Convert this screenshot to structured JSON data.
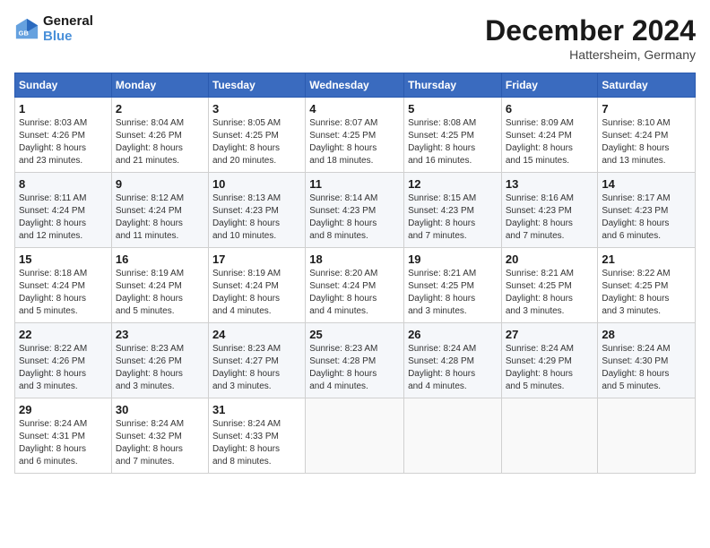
{
  "header": {
    "logo_line1": "General",
    "logo_line2": "Blue",
    "month_title": "December 2024",
    "location": "Hattersheim, Germany"
  },
  "days_of_week": [
    "Sunday",
    "Monday",
    "Tuesday",
    "Wednesday",
    "Thursday",
    "Friday",
    "Saturday"
  ],
  "weeks": [
    [
      {
        "day": "1",
        "info": "Sunrise: 8:03 AM\nSunset: 4:26 PM\nDaylight: 8 hours\nand 23 minutes."
      },
      {
        "day": "2",
        "info": "Sunrise: 8:04 AM\nSunset: 4:26 PM\nDaylight: 8 hours\nand 21 minutes."
      },
      {
        "day": "3",
        "info": "Sunrise: 8:05 AM\nSunset: 4:25 PM\nDaylight: 8 hours\nand 20 minutes."
      },
      {
        "day": "4",
        "info": "Sunrise: 8:07 AM\nSunset: 4:25 PM\nDaylight: 8 hours\nand 18 minutes."
      },
      {
        "day": "5",
        "info": "Sunrise: 8:08 AM\nSunset: 4:25 PM\nDaylight: 8 hours\nand 16 minutes."
      },
      {
        "day": "6",
        "info": "Sunrise: 8:09 AM\nSunset: 4:24 PM\nDaylight: 8 hours\nand 15 minutes."
      },
      {
        "day": "7",
        "info": "Sunrise: 8:10 AM\nSunset: 4:24 PM\nDaylight: 8 hours\nand 13 minutes."
      }
    ],
    [
      {
        "day": "8",
        "info": "Sunrise: 8:11 AM\nSunset: 4:24 PM\nDaylight: 8 hours\nand 12 minutes."
      },
      {
        "day": "9",
        "info": "Sunrise: 8:12 AM\nSunset: 4:24 PM\nDaylight: 8 hours\nand 11 minutes."
      },
      {
        "day": "10",
        "info": "Sunrise: 8:13 AM\nSunset: 4:23 PM\nDaylight: 8 hours\nand 10 minutes."
      },
      {
        "day": "11",
        "info": "Sunrise: 8:14 AM\nSunset: 4:23 PM\nDaylight: 8 hours\nand 8 minutes."
      },
      {
        "day": "12",
        "info": "Sunrise: 8:15 AM\nSunset: 4:23 PM\nDaylight: 8 hours\nand 7 minutes."
      },
      {
        "day": "13",
        "info": "Sunrise: 8:16 AM\nSunset: 4:23 PM\nDaylight: 8 hours\nand 7 minutes."
      },
      {
        "day": "14",
        "info": "Sunrise: 8:17 AM\nSunset: 4:23 PM\nDaylight: 8 hours\nand 6 minutes."
      }
    ],
    [
      {
        "day": "15",
        "info": "Sunrise: 8:18 AM\nSunset: 4:24 PM\nDaylight: 8 hours\nand 5 minutes."
      },
      {
        "day": "16",
        "info": "Sunrise: 8:19 AM\nSunset: 4:24 PM\nDaylight: 8 hours\nand 5 minutes."
      },
      {
        "day": "17",
        "info": "Sunrise: 8:19 AM\nSunset: 4:24 PM\nDaylight: 8 hours\nand 4 minutes."
      },
      {
        "day": "18",
        "info": "Sunrise: 8:20 AM\nSunset: 4:24 PM\nDaylight: 8 hours\nand 4 minutes."
      },
      {
        "day": "19",
        "info": "Sunrise: 8:21 AM\nSunset: 4:25 PM\nDaylight: 8 hours\nand 3 minutes."
      },
      {
        "day": "20",
        "info": "Sunrise: 8:21 AM\nSunset: 4:25 PM\nDaylight: 8 hours\nand 3 minutes."
      },
      {
        "day": "21",
        "info": "Sunrise: 8:22 AM\nSunset: 4:25 PM\nDaylight: 8 hours\nand 3 minutes."
      }
    ],
    [
      {
        "day": "22",
        "info": "Sunrise: 8:22 AM\nSunset: 4:26 PM\nDaylight: 8 hours\nand 3 minutes."
      },
      {
        "day": "23",
        "info": "Sunrise: 8:23 AM\nSunset: 4:26 PM\nDaylight: 8 hours\nand 3 minutes."
      },
      {
        "day": "24",
        "info": "Sunrise: 8:23 AM\nSunset: 4:27 PM\nDaylight: 8 hours\nand 3 minutes."
      },
      {
        "day": "25",
        "info": "Sunrise: 8:23 AM\nSunset: 4:28 PM\nDaylight: 8 hours\nand 4 minutes."
      },
      {
        "day": "26",
        "info": "Sunrise: 8:24 AM\nSunset: 4:28 PM\nDaylight: 8 hours\nand 4 minutes."
      },
      {
        "day": "27",
        "info": "Sunrise: 8:24 AM\nSunset: 4:29 PM\nDaylight: 8 hours\nand 5 minutes."
      },
      {
        "day": "28",
        "info": "Sunrise: 8:24 AM\nSunset: 4:30 PM\nDaylight: 8 hours\nand 5 minutes."
      }
    ],
    [
      {
        "day": "29",
        "info": "Sunrise: 8:24 AM\nSunset: 4:31 PM\nDaylight: 8 hours\nand 6 minutes."
      },
      {
        "day": "30",
        "info": "Sunrise: 8:24 AM\nSunset: 4:32 PM\nDaylight: 8 hours\nand 7 minutes."
      },
      {
        "day": "31",
        "info": "Sunrise: 8:24 AM\nSunset: 4:33 PM\nDaylight: 8 hours\nand 8 minutes."
      },
      {
        "day": "",
        "info": ""
      },
      {
        "day": "",
        "info": ""
      },
      {
        "day": "",
        "info": ""
      },
      {
        "day": "",
        "info": ""
      }
    ]
  ]
}
